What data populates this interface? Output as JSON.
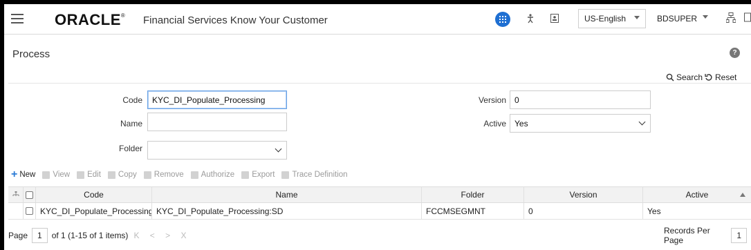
{
  "header": {
    "logo": "ORACLE",
    "logo_mark": "®",
    "product": "Financial Services Know Your Customer",
    "language": "US-English",
    "user": "BDSUPER"
  },
  "page": {
    "title": "Process",
    "help_glyph": "?",
    "search_label": "Search",
    "reset_label": "Reset"
  },
  "form": {
    "code_label": "Code",
    "code_value": "KYC_DI_Populate_Processing",
    "name_label": "Name",
    "name_value": "",
    "folder_label": "Folder",
    "folder_value": "",
    "version_label": "Version",
    "version_value": "0",
    "active_label": "Active",
    "active_value": "Yes"
  },
  "toolbar": {
    "new": "New",
    "view": "View",
    "edit": "Edit",
    "copy": "Copy",
    "remove": "Remove",
    "authorize": "Authorize",
    "export": "Export",
    "trace": "Trace Definition"
  },
  "grid": {
    "columns": [
      "Code",
      "Name",
      "Folder",
      "Version",
      "Active"
    ],
    "rows": [
      {
        "code": "KYC_DI_Populate_Processing",
        "name": "KYC_DI_Populate_Processing:SD",
        "folder": "FCCMSEGMNT",
        "version": "0",
        "active": "Yes"
      }
    ]
  },
  "pager": {
    "page_label": "Page",
    "page_value": "1",
    "summary": "of 1 (1-15 of 1 items)",
    "nav": "K < > X",
    "records_label": "Records Per Page",
    "records_value": "1"
  },
  "colors": {
    "accent": "#1e6fd2",
    "focus_border": "#6aa3e6"
  },
  "icons": {
    "menu": "hamburger-menu-icon",
    "apps": "apps-grid-icon",
    "accessibility": "accessibility-icon",
    "profile": "profile-card-icon",
    "hierarchy": "hierarchy-icon"
  }
}
